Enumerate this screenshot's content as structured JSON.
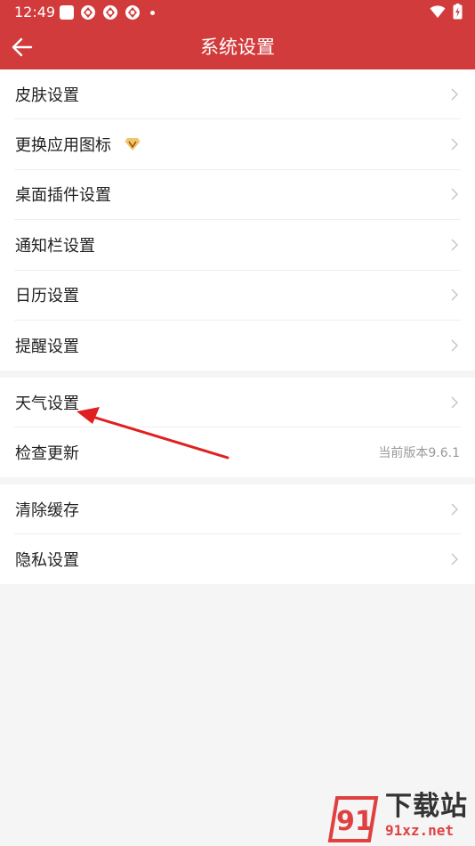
{
  "status_bar": {
    "time": "12:49"
  },
  "header": {
    "title": "系统设置"
  },
  "groups": [
    {
      "items": [
        {
          "label": "皮肤设置"
        },
        {
          "label": "更换应用图标"
        },
        {
          "label": "桌面插件设置"
        },
        {
          "label": "通知栏设置"
        },
        {
          "label": "日历设置"
        },
        {
          "label": "提醒设置"
        }
      ]
    },
    {
      "items": [
        {
          "label": "天气设置"
        },
        {
          "label": "检查更新",
          "value": "当前版本9.6.1"
        }
      ]
    },
    {
      "items": [
        {
          "label": "清除缓存"
        },
        {
          "label": "隐私设置"
        }
      ]
    }
  ],
  "watermark": {
    "text": "下载站",
    "url": "91xz.net",
    "logo_text": "91"
  },
  "colors": {
    "header_bg": "#d23b3b",
    "page_bg": "#f5f5f5",
    "annotation_arrow": "#e02020",
    "vip_badge": "#e8a53a"
  },
  "icons": {
    "back": "arrow-left-icon",
    "chevron": "chevron-right-icon",
    "vip": "diamond-icon"
  }
}
